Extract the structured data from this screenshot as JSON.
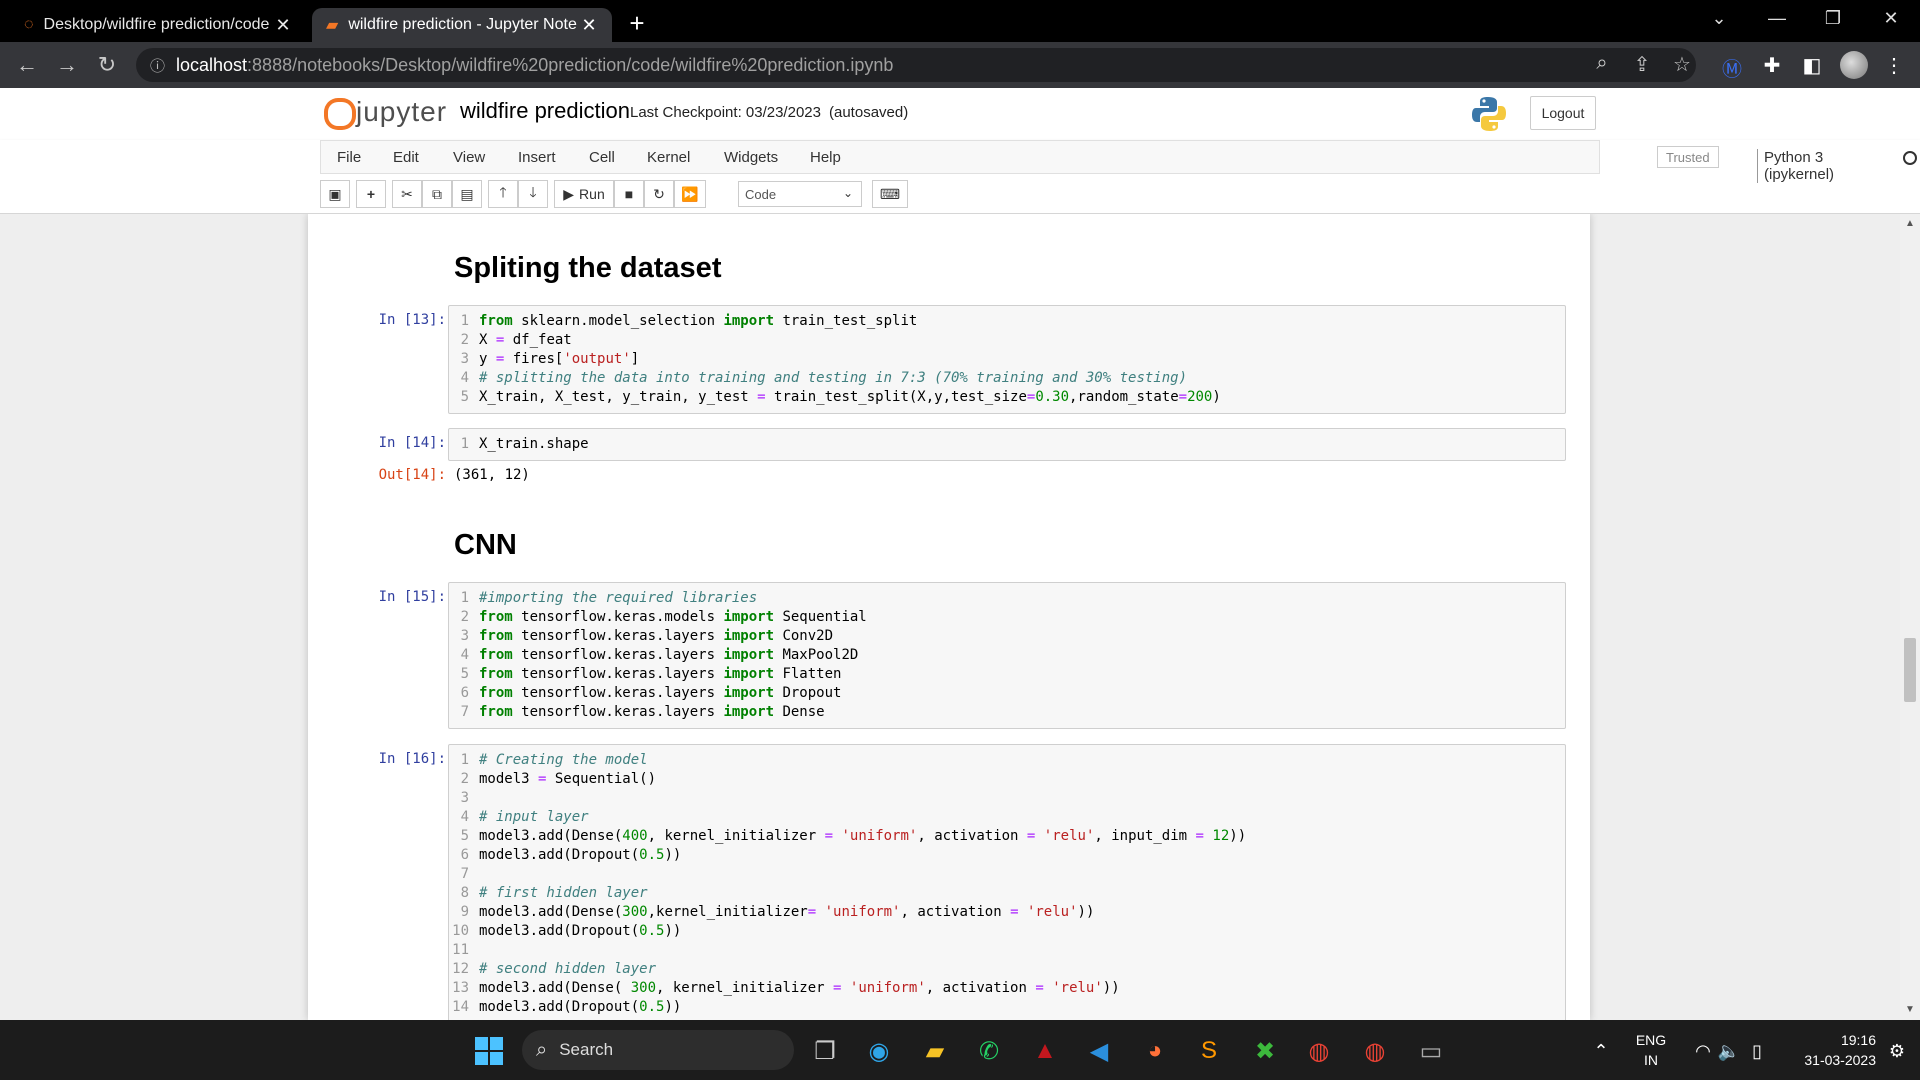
{
  "browser": {
    "tabs": [
      {
        "title": "Desktop/wildfire prediction/code",
        "close": "✕"
      },
      {
        "title": "wildfire prediction - Jupyter Note",
        "close": "✕"
      }
    ],
    "new_tab": "+",
    "url_host": "localhost",
    "url_path": ":8888/notebooks/Desktop/wildfire%20prediction/code/wildfire%20prediction.ipynb"
  },
  "jupyter": {
    "logo_text": "jupyter",
    "notebook_name": "wildfire prediction",
    "checkpoint": "Last Checkpoint: 03/23/2023",
    "autosave": "(autosaved)",
    "logout": "Logout",
    "menu": [
      "File",
      "Edit",
      "View",
      "Insert",
      "Cell",
      "Kernel",
      "Widgets",
      "Help"
    ],
    "trusted": "Trusted",
    "kernel": "Python 3 (ipykernel)",
    "toolbar": {
      "run_label": "Run",
      "cell_type": "Code"
    }
  },
  "notebook": {
    "heading_split": "Spliting the dataset",
    "heading_cnn": "CNN",
    "cells": [
      {
        "prompt": "In [13]:",
        "lines": [
          "from sklearn.model_selection import train_test_split",
          "X = df_feat",
          "y = fires['output']",
          "# splitting the data into training and testing in 7:3 (70% training and 30% testing)",
          "X_train, X_test, y_train, y_test = train_test_split(X,y,test_size=0.30,random_state=200)"
        ]
      },
      {
        "prompt": "In [14]:",
        "lines": [
          "X_train.shape"
        ],
        "out_prompt": "Out[14]:",
        "output": "(361, 12)"
      },
      {
        "prompt": "In [15]:",
        "lines": [
          "#importing the required libraries",
          "from tensorflow.keras.models import Sequential",
          "from tensorflow.keras.layers import Conv2D",
          "from tensorflow.keras.layers import MaxPool2D",
          "from tensorflow.keras.layers import Flatten",
          "from tensorflow.keras.layers import Dropout",
          "from tensorflow.keras.layers import Dense"
        ]
      },
      {
        "prompt": "In [16]:",
        "lines": [
          "# Creating the model",
          "model3 = Sequential()",
          "",
          "# input layer",
          "model3.add(Dense(400, kernel_initializer = 'uniform', activation = 'relu', input_dim = 12))",
          "model3.add(Dropout(0.5))",
          "",
          "# first hidden layer",
          "model3.add(Dense(300,kernel_initializer= 'uniform', activation = 'relu'))",
          "model3.add(Dropout(0.5))",
          "",
          "# second hidden layer",
          "model3.add(Dense( 300, kernel_initializer = 'uniform', activation = 'relu'))",
          "model3.add(Dropout(0.5))"
        ]
      }
    ]
  },
  "taskbar": {
    "search_placeholder": "Search",
    "lang_1": "ENG",
    "lang_2": "IN",
    "time": "19:16",
    "date": "31-03-2023"
  },
  "colors": {
    "jupyter_orange": "#f37726",
    "prompt_in": "#303f9f",
    "prompt_out": "#d84315",
    "keyword": "#008000",
    "comment": "#408080",
    "string": "#ba2121"
  }
}
